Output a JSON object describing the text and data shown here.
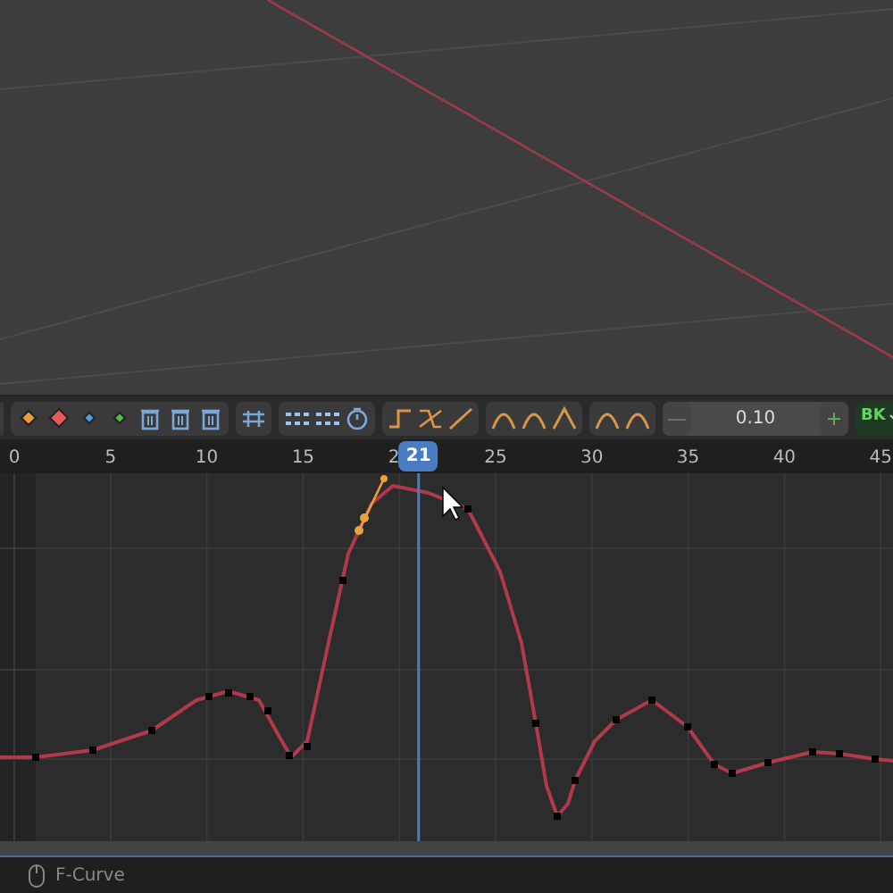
{
  "toolbar": {
    "step_field": {
      "value": "0.10",
      "minus": "—",
      "plus": "+"
    },
    "bake_menu": {
      "label": "BK"
    }
  },
  "ruler": {
    "ticks": [
      "0",
      "5",
      "10",
      "15",
      "2",
      "25",
      "30",
      "35",
      "40",
      "45"
    ],
    "current_frame": "21"
  },
  "status_bar": {
    "text": "F-Curve"
  }
}
